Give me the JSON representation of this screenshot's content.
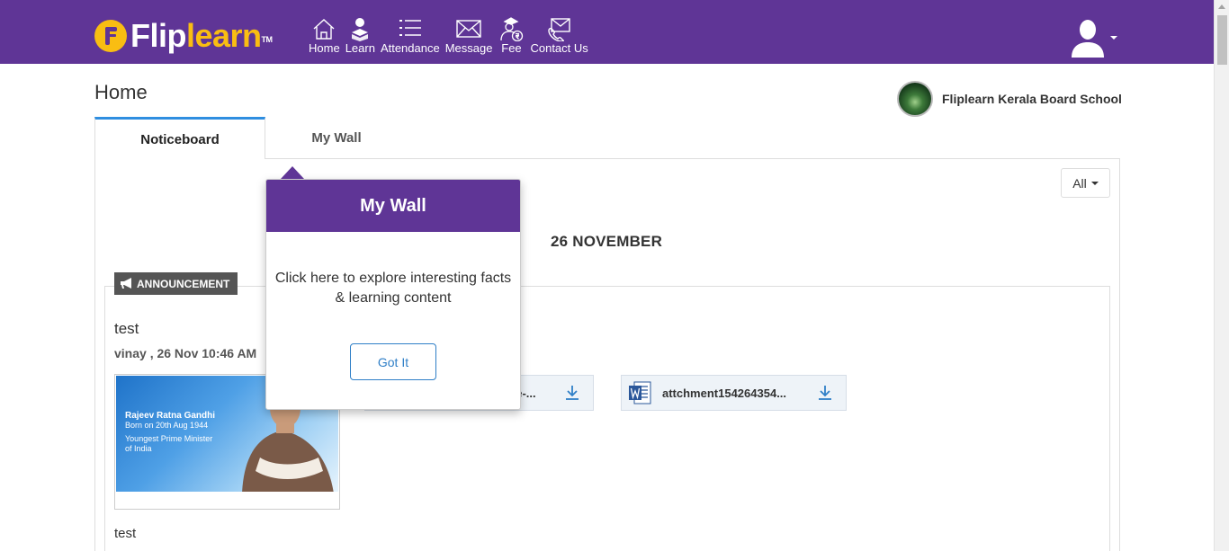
{
  "brand": {
    "logo_white": "Flip",
    "logo_yellow": "learn",
    "trademark": "TM",
    "colors": {
      "primary": "#5f3596",
      "accent": "#f9bd12",
      "link": "#2f7fc7",
      "tab_active": "#2f8ee0"
    }
  },
  "nav": {
    "items": [
      {
        "label": "Home",
        "icon": "home-icon"
      },
      {
        "label": "Learn",
        "icon": "learn-icon"
      },
      {
        "label": "Attendance",
        "icon": "attendance-icon"
      },
      {
        "label": "Message",
        "icon": "message-icon"
      },
      {
        "label": "Fee",
        "icon": "fee-icon"
      },
      {
        "label": "Contact Us",
        "icon": "contact-icon"
      }
    ],
    "user_icon": "user-avatar-icon"
  },
  "page": {
    "title": "Home",
    "school_name": "Fliplearn Kerala Board School"
  },
  "tabs": [
    {
      "label": "Noticeboard",
      "active": true
    },
    {
      "label": "My Wall",
      "active": false
    }
  ],
  "filter": {
    "selected": "All"
  },
  "feed": {
    "date_heading": "26 NOVEMBER",
    "post": {
      "badge": "ANNOUNCEMENT",
      "title": "test",
      "meta": "vinay , 26 Nov 10:46 AM",
      "image_text": {
        "name": "Rajeev Ratna Gandhi",
        "born": "Born on 20th Aug 1944",
        "line1": "Youngest Prime Minister",
        "line2": "of India"
      },
      "attachments": [
        {
          "name": "ee-...",
          "icon": "download-icon"
        },
        {
          "name": "attchment154264354...",
          "icon": "word-doc-icon"
        }
      ],
      "footer_text": "test"
    }
  },
  "popover": {
    "title": "My Wall",
    "body": "Click here to explore interesting facts & learning content",
    "button": "Got It"
  }
}
